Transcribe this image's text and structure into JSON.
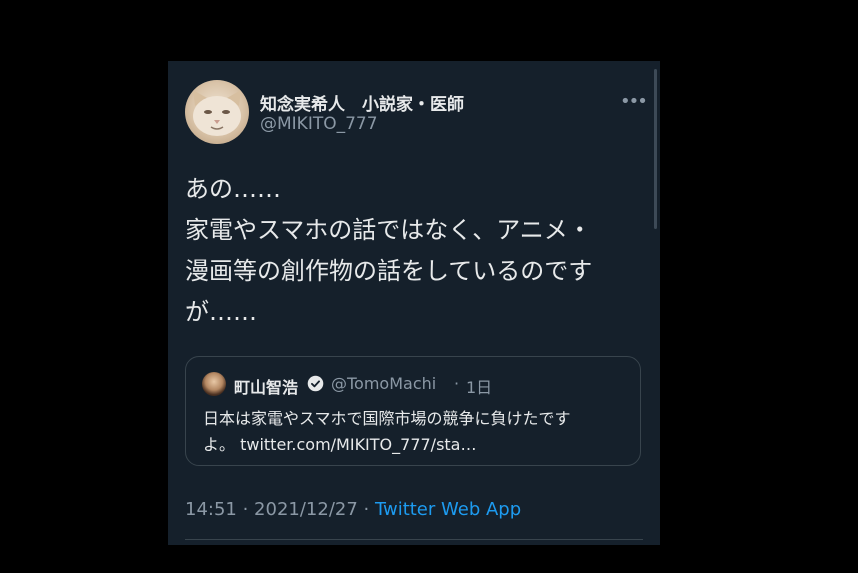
{
  "tweet": {
    "author": {
      "display_name": "知念実希人　小説家・医師",
      "handle": "@MIKITO_777"
    },
    "more_glyph": "•••",
    "text_lines": [
      "あの……",
      "家電やスマホの話ではなく、アニメ・",
      "漫画等の創作物の話をしているのです",
      "が……"
    ],
    "timestamp": "14:51 · 2021/12/27 · ",
    "app": "Twitter Web App"
  },
  "quoted": {
    "name": "町山智浩",
    "handle": "@TomoMachi",
    "separator": "·",
    "time": "1日",
    "text_lines": [
      "日本は家電やスマホで国際市場の競争に負けたです",
      "よ。 twitter.com/MIKITO_777/sta…"
    ]
  },
  "colors": {
    "background": "#15202b",
    "primary_text": "#e7e9ea",
    "secondary_text": "#8b98a5",
    "accent": "#1d9bf0",
    "border": "#38444d"
  },
  "icons": {
    "more": "more-horizontal-icon",
    "verified": "verified-badge-icon"
  }
}
